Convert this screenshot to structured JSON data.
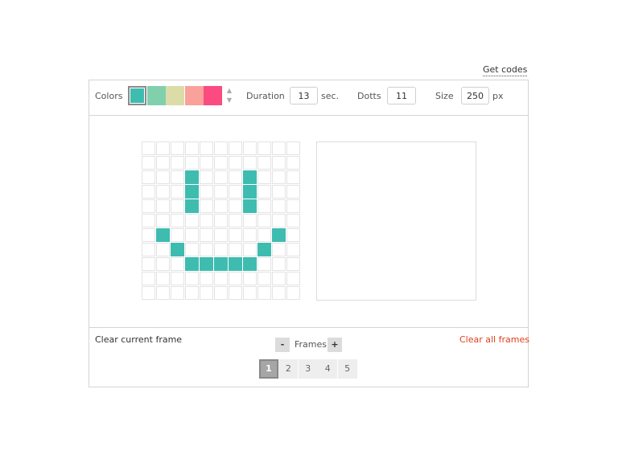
{
  "header": {
    "get_codes": "Get codes"
  },
  "toolbar": {
    "colors_label": "Colors",
    "swatches": [
      "#3fbcb0",
      "#82cfae",
      "#dcdca8",
      "#f9a19a",
      "#fb4b80"
    ],
    "duration_label": "Duration",
    "duration_value": "13",
    "duration_unit": "sec.",
    "dotts_label": "Dotts",
    "dotts_value": "11",
    "size_label": "Size",
    "size_value": "250",
    "size_unit": "px"
  },
  "grid": {
    "rows": 11,
    "cols": 11,
    "fill_color": "#3fbcb0",
    "filled": [
      [
        2,
        3
      ],
      [
        3,
        3
      ],
      [
        4,
        3
      ],
      [
        2,
        7
      ],
      [
        3,
        7
      ],
      [
        4,
        7
      ],
      [
        6,
        1
      ],
      [
        6,
        9
      ],
      [
        7,
        2
      ],
      [
        7,
        8
      ],
      [
        8,
        3
      ],
      [
        8,
        4
      ],
      [
        8,
        5
      ],
      [
        8,
        6
      ],
      [
        8,
        7
      ]
    ]
  },
  "footer": {
    "clear_current": "Clear current frame",
    "clear_all": "Clear all frames",
    "frames_label": "Frames",
    "minus": "-",
    "plus": "+",
    "pages": [
      "1",
      "2",
      "3",
      "4",
      "5"
    ],
    "active_page": "1"
  }
}
